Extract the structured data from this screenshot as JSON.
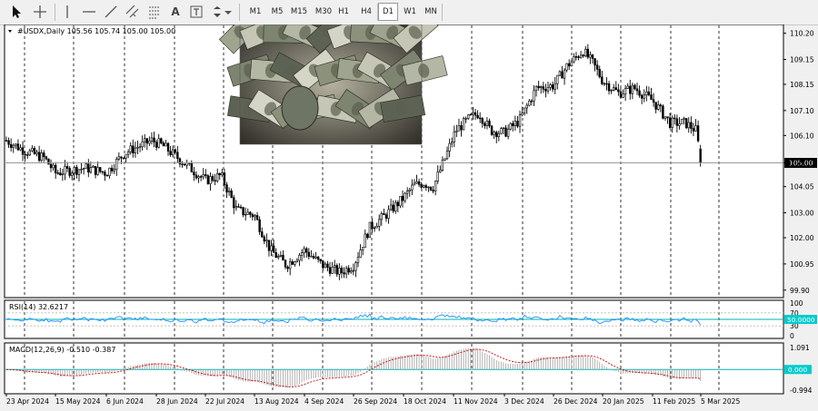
{
  "toolbar": {
    "timeframes": [
      "M1",
      "M5",
      "M15",
      "M30",
      "H1",
      "H4",
      "D1",
      "W1",
      "MN"
    ],
    "active_timeframe": "D1",
    "letter_tool": "A"
  },
  "colors": {
    "candle": "#000000",
    "price_line": "#9a9a9a",
    "price_tag_bg": "#000000",
    "rsi_line": "#1e90ff",
    "rsi_level_line": "#00b3b3",
    "rsi_tag_bg": "#00cccc",
    "macd_hist": "#a9a9a9",
    "macd_signal": "#cc0000",
    "macd_zero_line": "#00b3b3",
    "macd_tag_bg": "#00cccc",
    "grid_line": "#000000"
  },
  "main": {
    "header": "#USDX,Daily  105.56 105.74 105.00 105.00",
    "current_price_label": "105.00",
    "current_price": 105.0,
    "photo_icon": "us-dollar-banknotes-photo"
  },
  "rsi": {
    "label": "RSI(14) 32.6217",
    "value_tag": "50.0000",
    "ticks": [
      "100",
      "70",
      "30",
      "0"
    ]
  },
  "macd": {
    "label": "MACD(12,26,9) -0.510 -0.387",
    "value_tag": "0.000",
    "ticks": [
      "1.091",
      "-0.994"
    ]
  },
  "chart_data": {
    "type": "candlestick",
    "symbol": "#USDX",
    "timeframe": "Daily",
    "last_bar": {
      "open": 105.56,
      "high": 105.74,
      "low": 105.0,
      "close": 105.0
    },
    "ylim": [
      99.6,
      110.55
    ],
    "y_ticks": [
      110.2,
      109.15,
      108.15,
      107.1,
      106.1,
      105.0,
      104.05,
      103.0,
      102.0,
      100.95,
      99.9
    ],
    "x_tick_labels": [
      "23 Apr 2024",
      "15 May 2024",
      "6 Jun 2024",
      "28 Jun 2024",
      "22 Jul 2024",
      "13 Aug 2024",
      "4 Sep 2024",
      "26 Sep 2024",
      "18 Oct 2024",
      "11 Nov 2024",
      "3 Dec 2024",
      "26 Dec 2024",
      "20 Jan 2025",
      "11 Feb 2025",
      "5 Mar 2025"
    ],
    "close_path": {
      "x": [
        "23 Apr 2024",
        "1 May 2024",
        "10 May 2024",
        "15 May 2024",
        "28 May 2024",
        "6 Jun 2024",
        "14 Jun 2024",
        "26 Jun 2024",
        "1 Jul 2024",
        "10 Jul 2024",
        "22 Jul 2024",
        "29 Jul 2024",
        "5 Aug 2024",
        "13 Aug 2024",
        "20 Aug 2024",
        "27 Aug 2024",
        "4 Sep 2024",
        "12 Sep 2024",
        "20 Sep 2024",
        "26 Sep 2024",
        "3 Oct 2024",
        "10 Oct 2024",
        "18 Oct 2024",
        "23 Oct 2024",
        "28 Oct 2024",
        "1 Nov 2024",
        "6 Nov 2024",
        "12 Nov 2024",
        "18 Nov 2024",
        "22 Nov 2024",
        "27 Nov 2024",
        "3 Dec 2024",
        "10 Dec 2024",
        "18 Dec 2024",
        "26 Dec 2024",
        "2 Jan 2025",
        "10 Jan 2025",
        "15 Jan 2025",
        "20 Jan 2025",
        "27 Jan 2025",
        "3 Feb 2025",
        "11 Feb 2025",
        "19 Feb 2025",
        "26 Feb 2025",
        "3 Mar 2025",
        "5 Mar 2025"
      ],
      "close": [
        105.9,
        105.5,
        105.2,
        104.6,
        104.8,
        104.6,
        105.4,
        105.9,
        105.7,
        105.1,
        104.3,
        104.5,
        103.1,
        102.9,
        101.5,
        100.9,
        101.5,
        100.9,
        100.6,
        100.9,
        102.4,
        102.9,
        103.6,
        104.1,
        104.2,
        104.0,
        105.0,
        106.3,
        106.8,
        107.0,
        106.3,
        106.2,
        106.7,
        108.0,
        108.1,
        108.9,
        109.5,
        109.0,
        108.3,
        107.8,
        108.0,
        107.5,
        106.6,
        106.6,
        106.3,
        105.0
      ]
    },
    "rsi_data": {
      "ylim": [
        0,
        100
      ],
      "levels": [
        70,
        30
      ],
      "reference_level": 50,
      "last_value": 32.6217
    },
    "macd_data": {
      "ylim": [
        -0.994,
        1.091
      ],
      "last_main": -0.51,
      "last_signal": -0.387
    }
  }
}
